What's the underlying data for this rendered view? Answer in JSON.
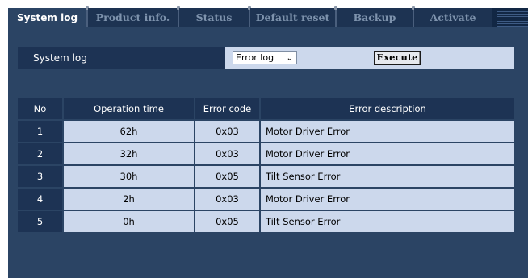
{
  "tabs": [
    {
      "label": "System log",
      "active": true
    },
    {
      "label": "Product info.",
      "active": false
    },
    {
      "label": "Status",
      "active": false
    },
    {
      "label": "Default reset",
      "active": false
    },
    {
      "label": "Backup",
      "active": false
    },
    {
      "label": "Activate",
      "active": false
    }
  ],
  "command": {
    "label": "System log",
    "select_value": "Error log",
    "execute_label": "Execute"
  },
  "table": {
    "headers": [
      "No",
      "Operation time",
      "Error code",
      "Error description"
    ],
    "rows": [
      {
        "no": "1",
        "time": "62h",
        "code": "0x03",
        "desc": "Motor Driver Error"
      },
      {
        "no": "2",
        "time": "32h",
        "code": "0x03",
        "desc": "Motor Driver Error"
      },
      {
        "no": "3",
        "time": "30h",
        "code": "0x05",
        "desc": "Tilt Sensor Error"
      },
      {
        "no": "4",
        "time": "2h",
        "code": "0x03",
        "desc": "Motor Driver Error"
      },
      {
        "no": "5",
        "time": "0h",
        "code": "0x05",
        "desc": "Tilt Sensor Error"
      }
    ]
  },
  "colors": {
    "panel": "#2b4464",
    "tab_bar": "#122744",
    "header_cell": "#1d3354",
    "data_cell": "#ccd8ec"
  }
}
